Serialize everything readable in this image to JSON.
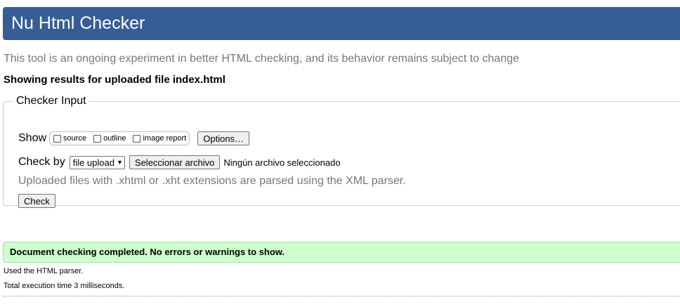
{
  "header": {
    "title": "Nu Html Checker"
  },
  "subtitle": "This tool is an ongoing experiment in better HTML checking, and its behavior remains subject to change",
  "results_for": "Showing results for uploaded file index.html",
  "checker_input": {
    "legend": "Checker Input",
    "show_label": "Show",
    "show_options": [
      {
        "label": "source",
        "checked": false
      },
      {
        "label": "outline",
        "checked": false
      },
      {
        "label": "image report",
        "checked": false
      }
    ],
    "options_button": "Options…",
    "check_by_label": "Check by",
    "check_by_selected": "file upload",
    "file_button": "Seleccionar archivo",
    "no_file_text": "Ningún archivo seleccionado",
    "xml_note": "Uploaded files with .xhtml or .xht extensions are parsed using the XML parser.",
    "check_button": "Check"
  },
  "results": {
    "success_message": "Document checking completed. No errors or warnings to show.",
    "parser_note": "Used the HTML parser.",
    "time_note": "Total execution time 3 milliseconds."
  },
  "colors": {
    "header_bg": "#365d95",
    "success_bg": "#ccffcc",
    "muted_text": "#777777"
  }
}
